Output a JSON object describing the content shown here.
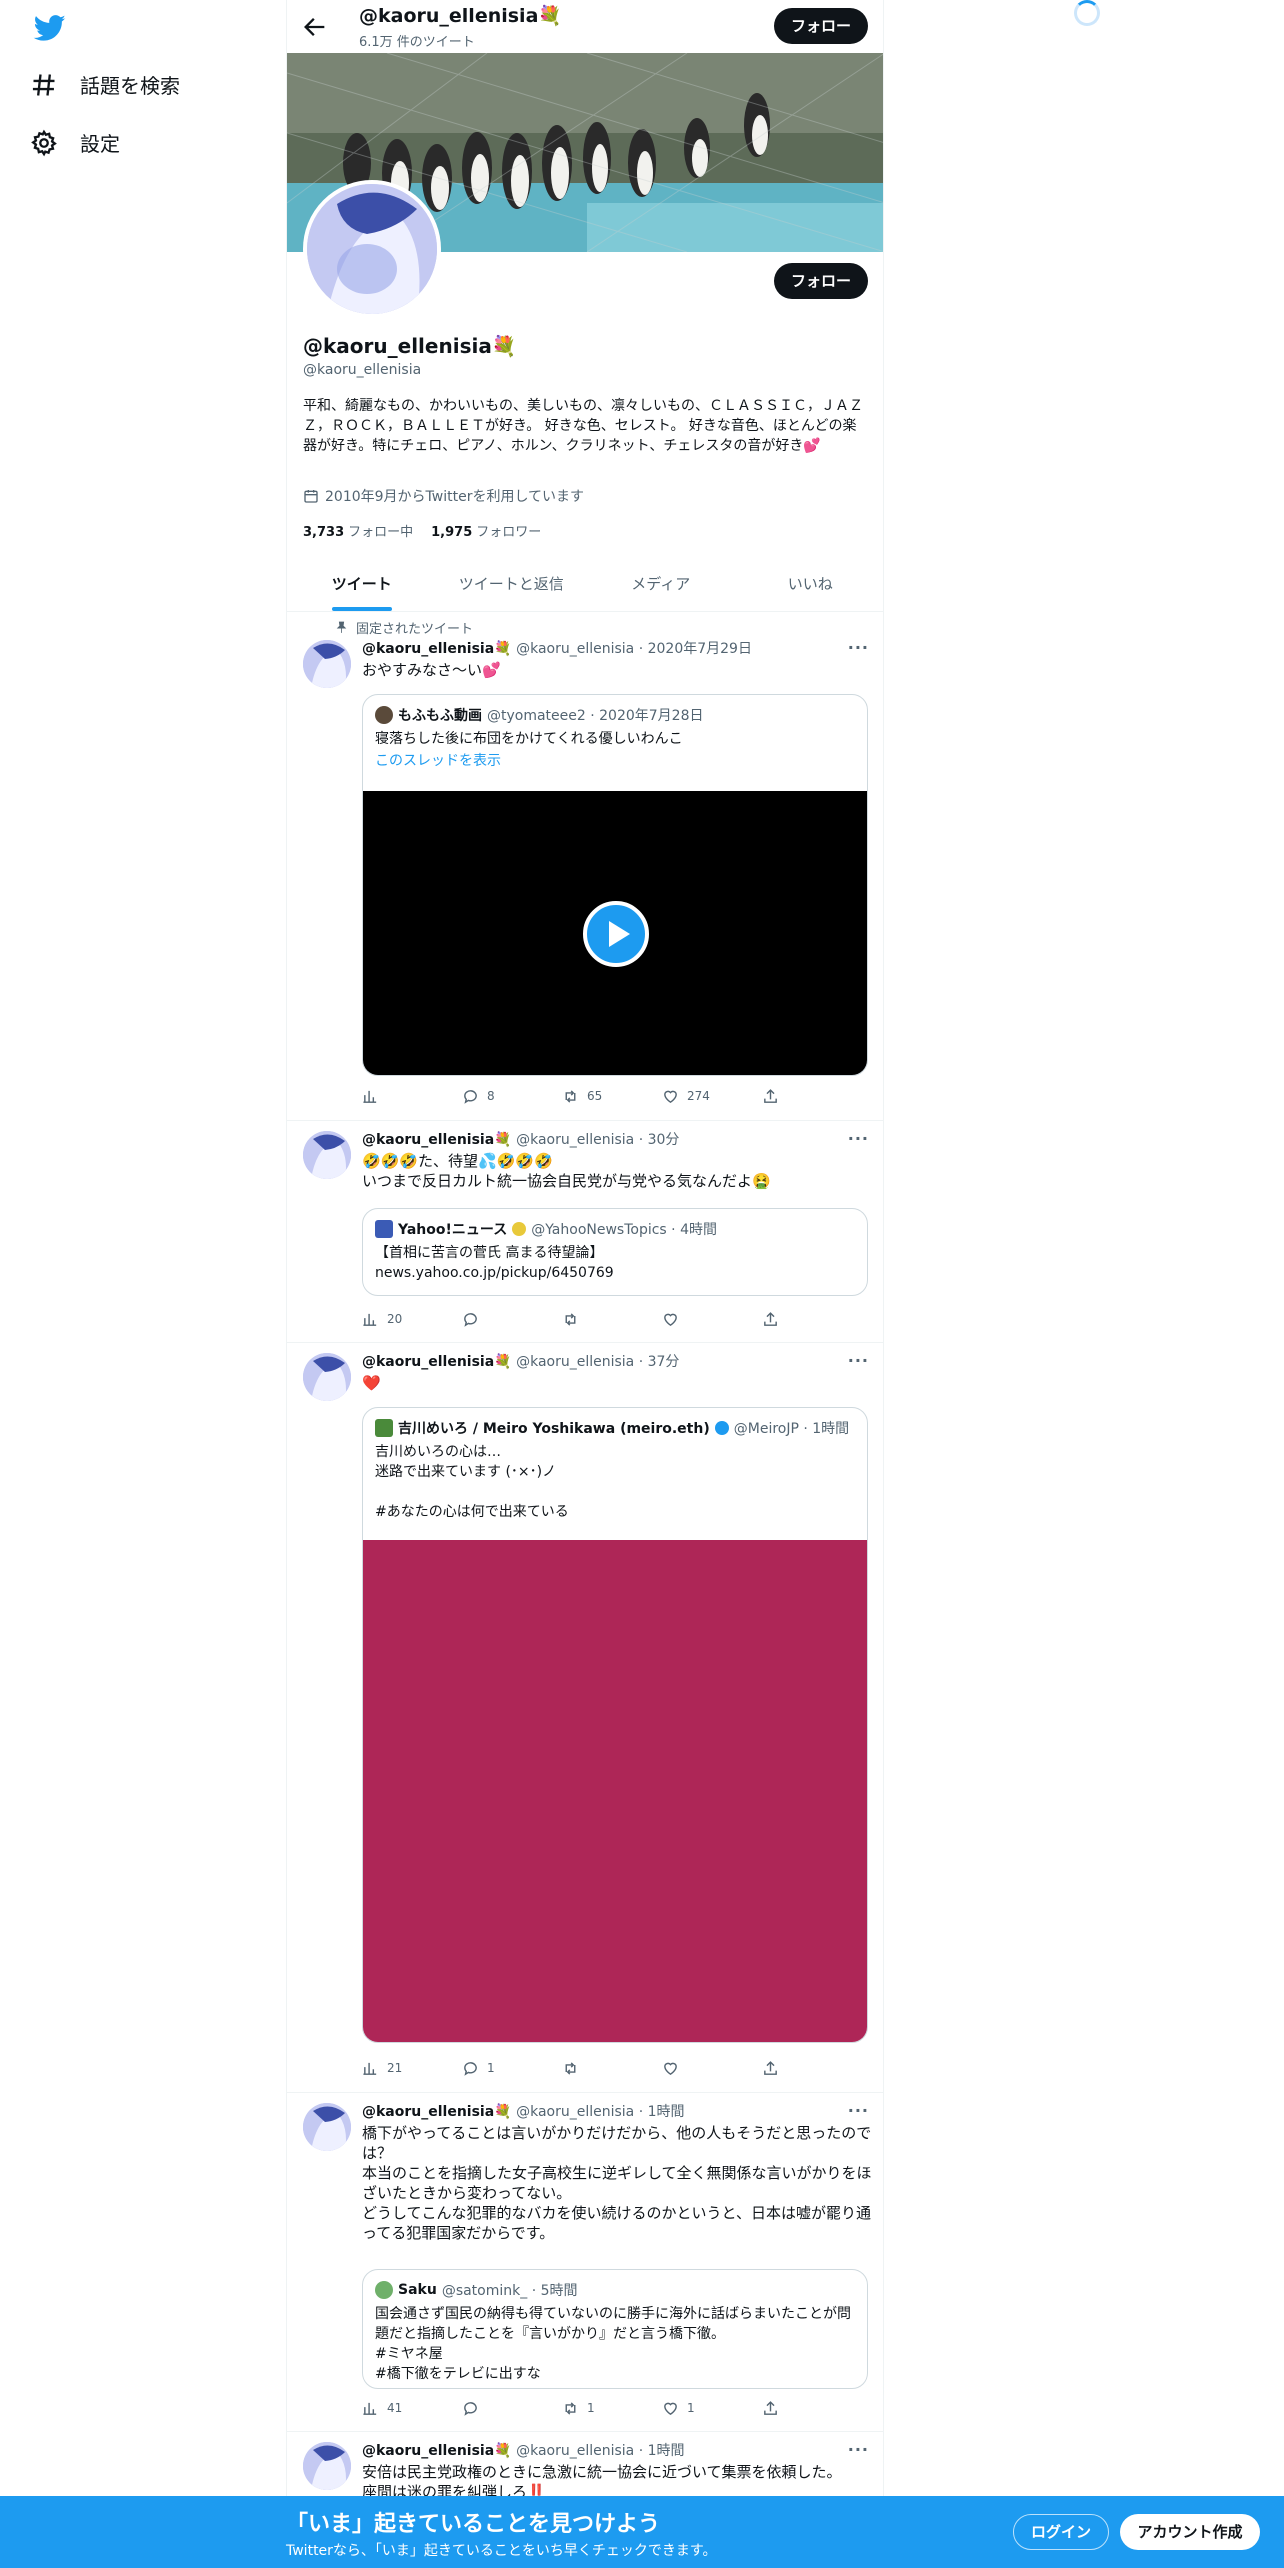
{
  "nav": {
    "explore_label": "話題を検索",
    "settings_label": "設定"
  },
  "header": {
    "name": "@kaoru_ellenisia💐",
    "tweet_count": "6.1万 件のツイート",
    "follow_label": "フォロー"
  },
  "profile": {
    "name": "@kaoru_ellenisia💐",
    "handle": "@kaoru_ellenisia",
    "bio": "平和、綺麗なもの、かわいいもの、美しいもの、凛々しいもの、ＣＬＡＳＳＩＣ，ＪＡＺＺ，ＲＯＣＫ，ＢＡＬＬＥＴが好き。 好きな色、セレスト。 好きな音色、ほとんどの楽器が好き。特にチェロ、ピアノ、ホルン、クラリネット、チェレスタの音が好き💕",
    "joined": "2010年9月からTwitterを利用しています",
    "following_count": "3,733",
    "following_label": "フォロー中",
    "followers_count": "1,975",
    "followers_label": "フォロワー",
    "follow_label": "フォロー"
  },
  "tabs": [
    "ツイート",
    "ツイートと返信",
    "メディア",
    "いいね"
  ],
  "pinned_label": "固定されたツイート",
  "tweets": [
    {
      "name": "@kaoru_ellenisia💐",
      "meta": "@kaoru_ellenisia · 2020年7月29日",
      "text": "おやすみなさ〜い💕",
      "quote": {
        "name": "もふもふ動画",
        "meta": "@tyomateee2 · 2020年7月28日",
        "text": "寝落ちした後に布団をかけてくれる優しいわんこ",
        "link": "このスレッドを表示"
      },
      "views": "",
      "replies": "8",
      "retweets": "65",
      "likes": "274"
    },
    {
      "name": "@kaoru_ellenisia💐",
      "meta": "@kaoru_ellenisia · 30分",
      "text": "🤣🤣🤣た、待望💦🤣🤣🤣\nいつまで反日カルト統一協会自民党が与党やる気なんだよ🤮",
      "quote": {
        "name": "Yahoo!ニュース",
        "meta": "@YahooNewsTopics · 4時間",
        "text": "【首相に苦言の菅氏 高まる待望論】\nnews.yahoo.co.jp/pickup/6450769"
      },
      "views": "20",
      "replies": "",
      "retweets": "",
      "likes": ""
    },
    {
      "name": "@kaoru_ellenisia💐",
      "meta": "@kaoru_ellenisia · 37分",
      "text": "❤️",
      "quote": {
        "name": "吉川めいろ / Meiro Yoshikawa (meiro.eth)",
        "meta": "@MeiroJP · 1時間",
        "text": "吉川めいろの心は…\n迷路で出来ています (･×･)ノ\n\n#あなたの心は何で出来ている"
      },
      "views": "21",
      "replies": "1",
      "retweets": "",
      "likes": ""
    },
    {
      "name": "@kaoru_ellenisia💐",
      "meta": "@kaoru_ellenisia · 1時間",
      "text": "橋下がやってることは言いがかりだけだから、他の人もそうだと思ったのでは？\n本当のことを指摘した女子高校生に逆ギレして全く無関係な言いがかりをほざいたときから変わってない。\nどうしてこんな犯罪的なバカを使い続けるのかというと、日本は嘘が罷り通ってる犯罪国家だからです。",
      "quote": {
        "name": "Saku",
        "meta": "@satomink_ · 5時間",
        "text": "国会通さず国民の納得も得ていないのに勝手に海外に話ばらまいたことが問題だと指摘したことを『言いがかり』だと言う橋下徹。\n#ミヤネ屋\n#橋下徹をテレビに出すな"
      },
      "views": "41",
      "replies": "",
      "retweets": "1",
      "likes": "1"
    },
    {
      "name": "@kaoru_ellenisia💐",
      "meta": "@kaoru_ellenisia · 1時間",
      "text": "安倍は民主党政権のときに急激に統一協会に近づいて集票を依頼した。\n座間は迷の罪を糾弾しろ‼️"
    }
  ],
  "bottom": {
    "title": "「いま」起きていることを見つけよう",
    "subtitle": "Twitterなら、「いま」起きていることをいち早くチェックできます。",
    "login": "ログイン",
    "signup": "アカウント作成"
  },
  "colors": {
    "accent": "#1d9bf0",
    "quote_image": "#ae2657"
  }
}
